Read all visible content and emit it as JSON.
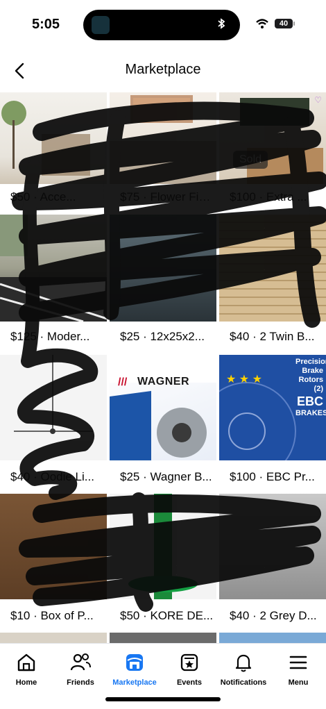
{
  "status": {
    "time": "5:05",
    "battery": "40"
  },
  "header": {
    "title": "Marketplace"
  },
  "listings": [
    {
      "caption": "$50 · Acce..."
    },
    {
      "caption": "$75 · Flower Fie..."
    },
    {
      "caption": "$100 · Extra ...",
      "badge": "Sold"
    },
    {
      "caption": "$125 · Moder..."
    },
    {
      "caption": "$25 · 12x25x2..."
    },
    {
      "caption": "$40 · 2 Twin B..."
    },
    {
      "caption": "$40 · Oodie Li..."
    },
    {
      "caption": "$25 · Wagner B..."
    },
    {
      "caption": "$100 · EBC Pr..."
    },
    {
      "caption": "$10 · Box of P..."
    },
    {
      "caption": "$50 · KORE DE..."
    },
    {
      "caption": "$40 · 2 Grey D..."
    }
  ],
  "thumb_text": {
    "wagner_brand": "WAGNER",
    "ebc_lines": [
      "Precision",
      "Brake",
      "Rotors (2)",
      "EBC",
      "BRAKES"
    ]
  },
  "tabs": [
    {
      "label": "Home",
      "icon": "home-icon"
    },
    {
      "label": "Friends",
      "icon": "friends-icon"
    },
    {
      "label": "Marketplace",
      "icon": "marketplace-icon",
      "active": true
    },
    {
      "label": "Events",
      "icon": "events-icon"
    },
    {
      "label": "Notifications",
      "icon": "bell-icon"
    },
    {
      "label": "Menu",
      "icon": "menu-icon"
    }
  ],
  "colors": {
    "accent": "#1877f2",
    "text": "#050505",
    "divider": "#e4e6eb"
  }
}
